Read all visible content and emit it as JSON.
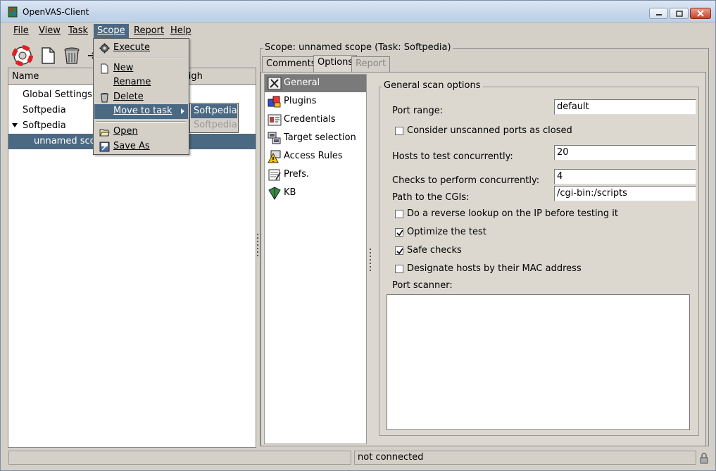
{
  "window": {
    "title": "OpenVAS-Client"
  },
  "menubar": {
    "items": [
      "File",
      "View",
      "Task",
      "Scope",
      "Report",
      "Help"
    ],
    "active": "Scope"
  },
  "scope_menu": {
    "items": [
      {
        "label": "Execute",
        "icon": "gear-icon"
      },
      {
        "label": "New",
        "icon": "new-document-icon"
      },
      {
        "label": "Rename",
        "icon": ""
      },
      {
        "label": "Delete",
        "icon": "trash-icon"
      },
      {
        "label": "Move to task",
        "icon": "",
        "submenu": true
      },
      {
        "label": "Open",
        "icon": "folder-open-icon"
      },
      {
        "label": "Save As",
        "icon": "save-icon"
      }
    ],
    "submenu": [
      "Softpedia",
      "Softpedia"
    ]
  },
  "tree": {
    "columns": [
      "Name",
      "High"
    ],
    "rows": [
      {
        "label": "Global Settings",
        "level": 0
      },
      {
        "label": "Softpedia",
        "level": 0
      },
      {
        "label": "Softpedia",
        "level": 0,
        "expanded": true
      },
      {
        "label": "unnamed scope",
        "level": 1,
        "selected": true
      }
    ]
  },
  "scope_panel": {
    "label": "Scope: unnamed scope (Task: Softpedia)",
    "tabs": [
      "Comments",
      "Options",
      "Report"
    ],
    "active_tab": "Options",
    "sections": [
      "General",
      "Plugins",
      "Credentials",
      "Target selection",
      "Access Rules",
      "Prefs.",
      "KB"
    ],
    "active_section": "General"
  },
  "general_options": {
    "title": "General scan options",
    "port_range_label": "Port range:",
    "port_range_value": "default",
    "consider_unscanned_label": "Consider unscanned ports as closed",
    "consider_unscanned_checked": false,
    "hosts_concurrent_label": "Hosts to test concurrently:",
    "hosts_concurrent_value": "20",
    "checks_concurrent_label": "Checks to perform concurrently:",
    "checks_concurrent_value": "4",
    "cgi_path_label": "Path to the CGIs:",
    "cgi_path_value": "/cgi-bin:/scripts",
    "reverse_lookup_label": "Do a reverse lookup on the IP before testing it",
    "reverse_lookup_checked": false,
    "optimize_label": "Optimize the test",
    "optimize_checked": true,
    "safe_checks_label": "Safe checks",
    "safe_checks_checked": true,
    "mac_address_label": "Designate hosts by their MAC address",
    "mac_address_checked": false,
    "port_scanner_label": "Port scanner:"
  },
  "statusbar": {
    "left": "",
    "right": "not connected"
  },
  "colors": {
    "selection": "#4b6983",
    "window_bg": "#d4d0c8",
    "section_selected": "#7a7a7a"
  }
}
